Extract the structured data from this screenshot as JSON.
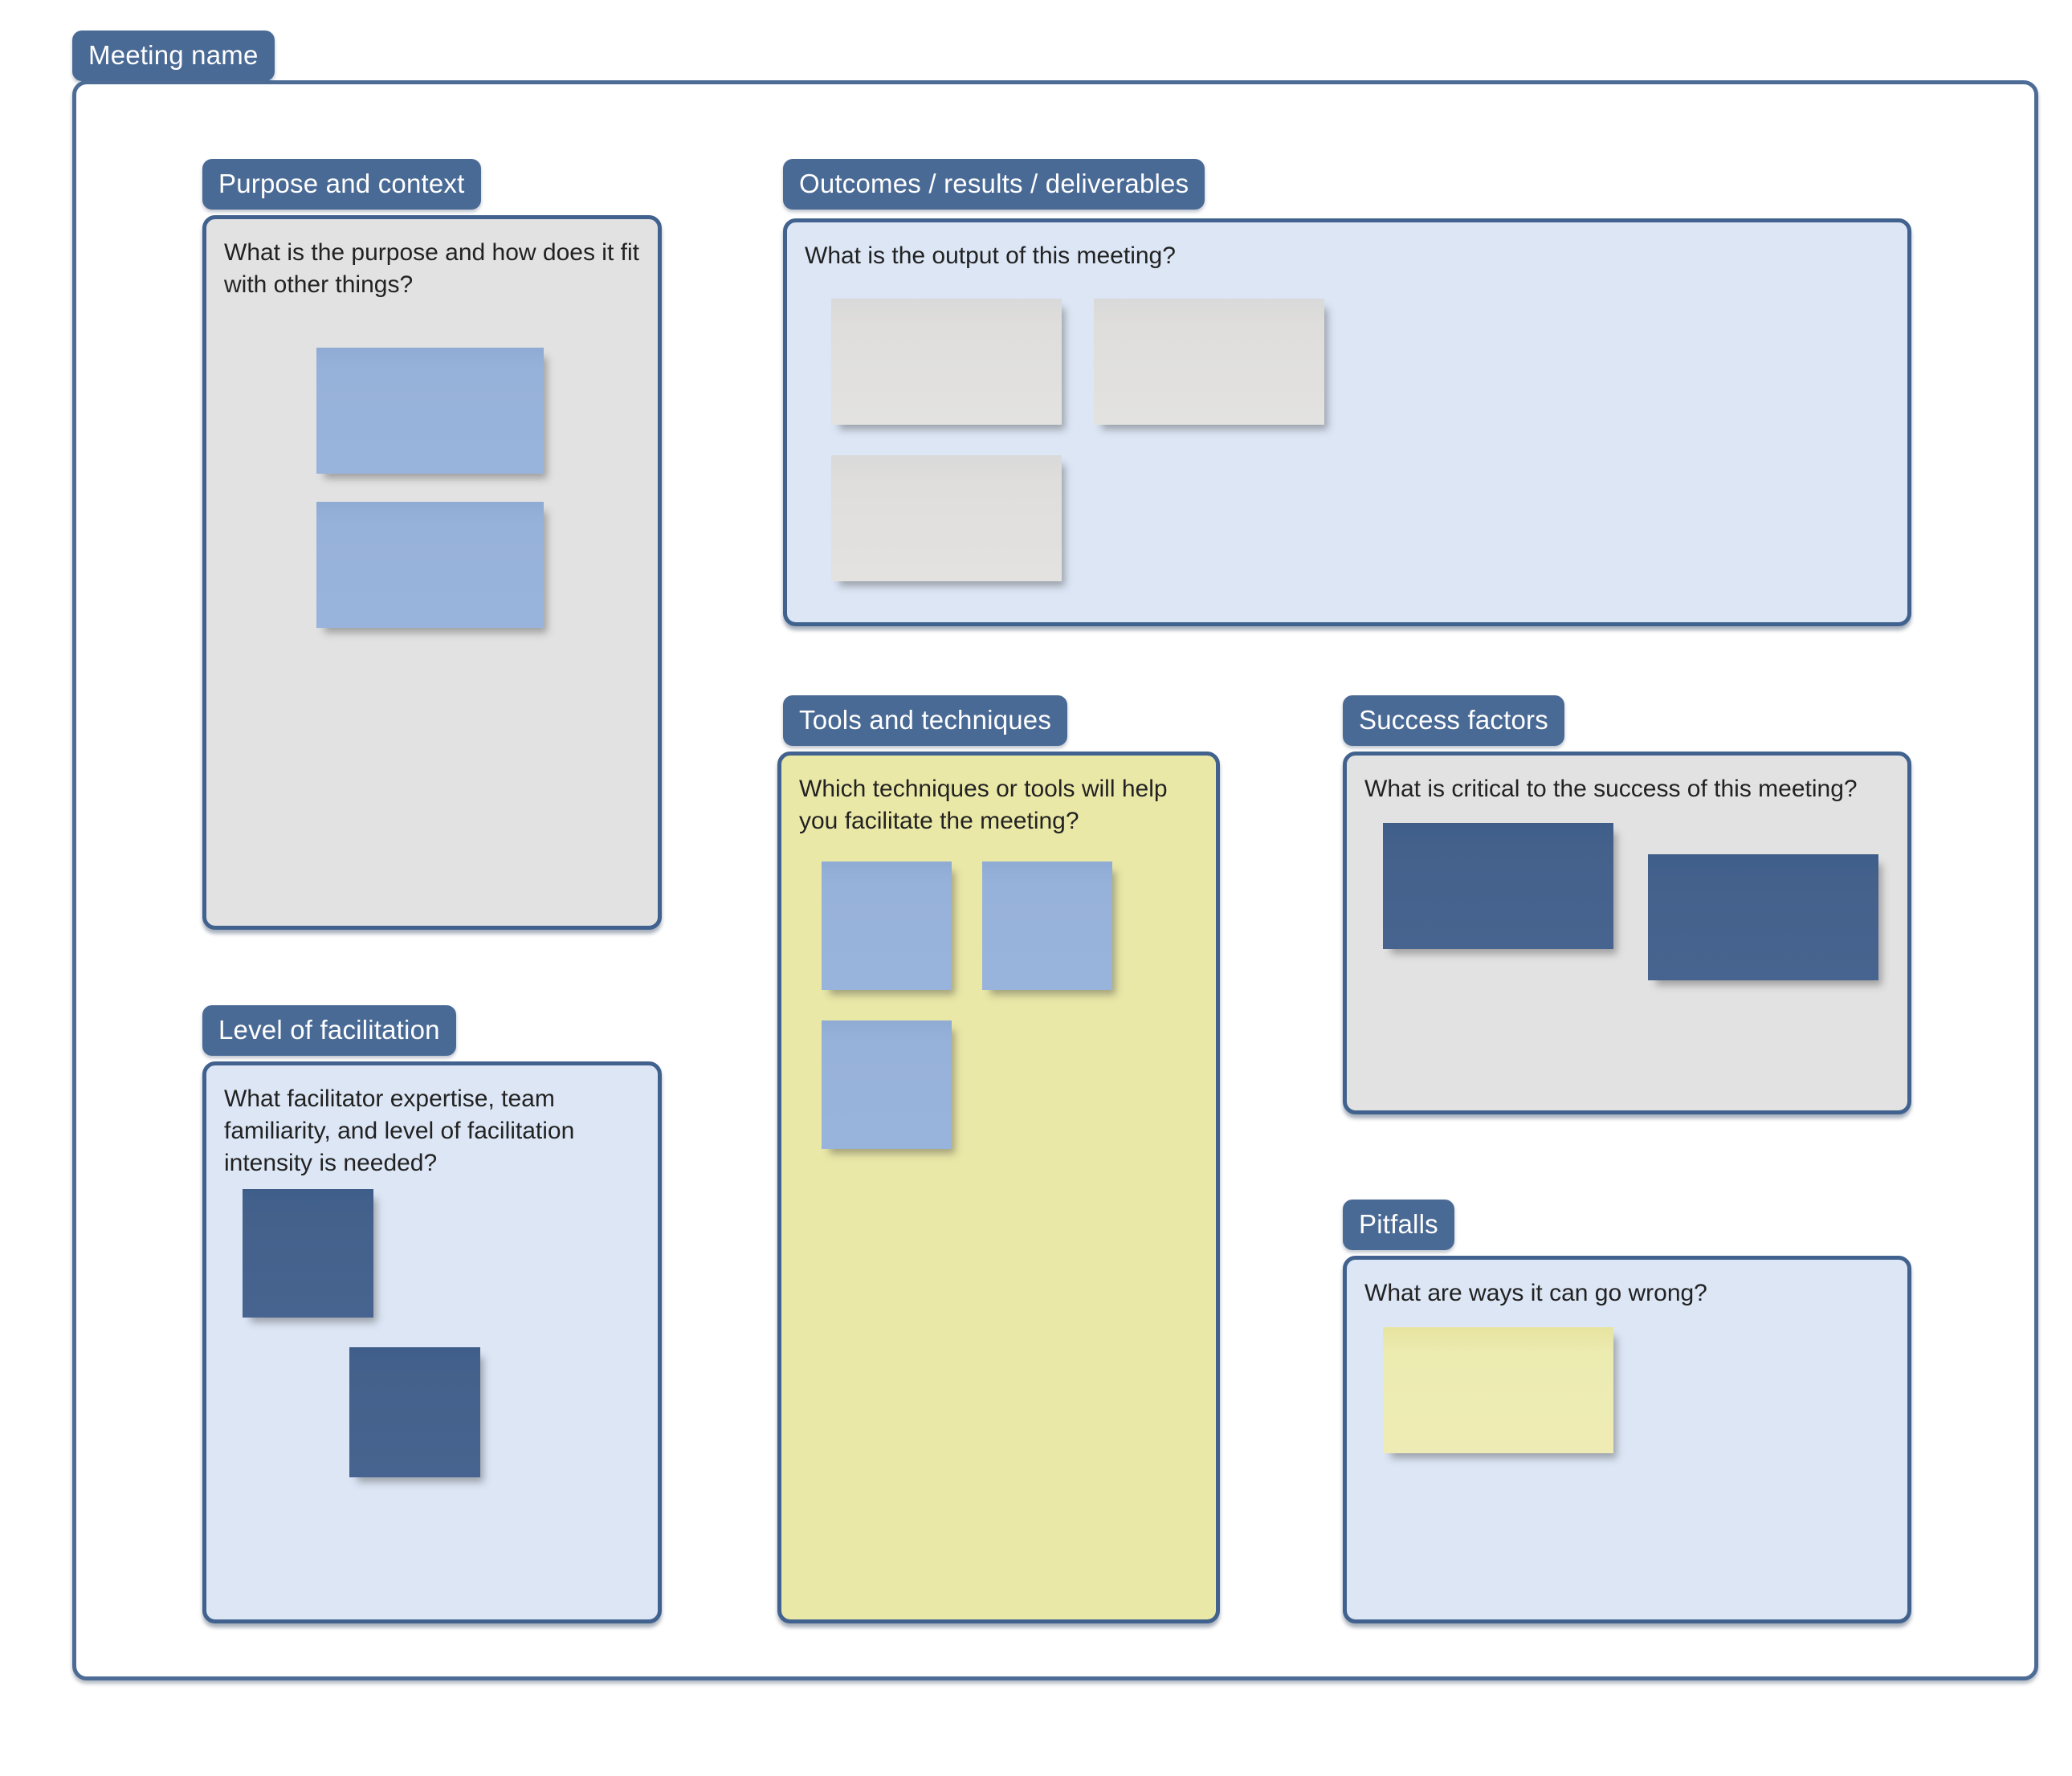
{
  "board": {
    "title": "Meeting name",
    "accent_color": "#4a6a96",
    "border_color": "#41628e"
  },
  "sections": [
    {
      "id": "purpose",
      "tag": "Purpose and context",
      "prompt": "What is the purpose and how does it fit with other things?",
      "card_color": "#e2e2e2",
      "note_color": "#99b4dc",
      "note_count": 2
    },
    {
      "id": "outcomes",
      "tag": "Outcomes / results / deliverables",
      "prompt": "What is the output of this meeting?",
      "card_color": "#dce6f5",
      "note_color": "#e3e2e0",
      "note_count": 3
    },
    {
      "id": "level-of-facilitation",
      "tag": "Level of facilitation",
      "prompt": "What facilitator expertise, team familiarity, and level of facilitation intensity is needed?",
      "card_color": "#dce6f5",
      "note_color": "#46648f",
      "note_count": 2
    },
    {
      "id": "tools",
      "tag": "Tools and techniques",
      "prompt": "Which techniques or tools will help you facilitate the meeting?",
      "card_color": "#eae8a7",
      "note_color": "#99b4dc",
      "note_count": 3
    },
    {
      "id": "success-factors",
      "tag": "Success factors",
      "prompt": "What is critical to the success of this meeting?",
      "card_color": "#e2e2e2",
      "note_color": "#46648f",
      "note_count": 2
    },
    {
      "id": "pitfalls",
      "tag": "Pitfalls",
      "prompt": "What are ways it can go wrong?",
      "card_color": "#dce6f5",
      "note_color": "#eeecb4",
      "note_count": 1
    }
  ]
}
